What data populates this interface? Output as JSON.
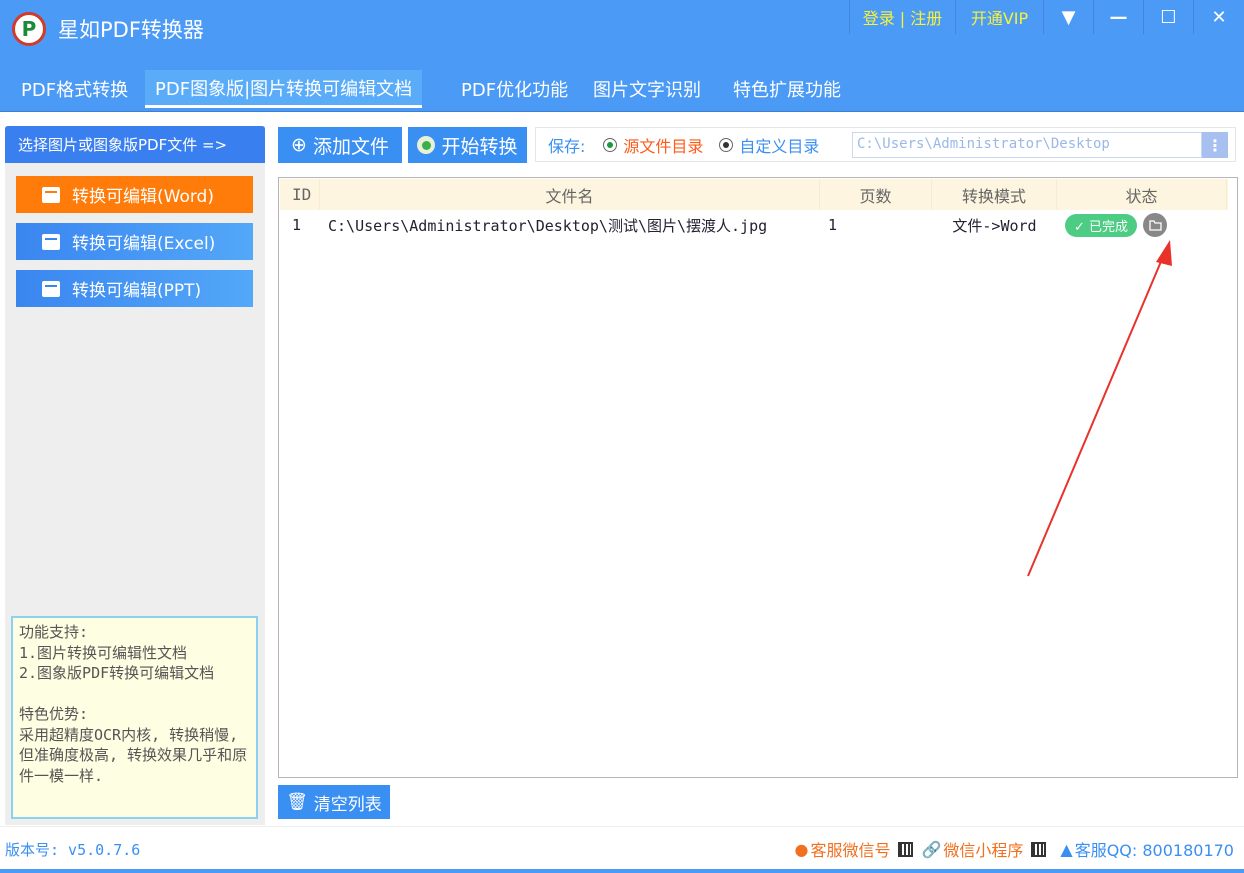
{
  "app": {
    "title": "星如PDF转换器",
    "logo_letter": "P"
  },
  "titlebar": {
    "login": "登录 | 注册",
    "vip": "开通VIP",
    "menu_icon": "▼",
    "minimize": "—",
    "maximize": "☐",
    "close": "✕"
  },
  "tabs": [
    "PDF格式转换",
    "PDF图象版|图片转换可编辑文档",
    "PDF优化功能",
    "图片文字识别",
    "特色扩展功能"
  ],
  "sidebar": {
    "header": "选择图片或图象版PDF文件 =>",
    "items": [
      "转换可编辑(Word)",
      "转换可编辑(Excel)",
      "转换可编辑(PPT)"
    ],
    "info": "功能支持:\n1.图片转换可编辑性文档\n2.图象版PDF转换可编辑文档\n\n特色优势:\n采用超精度OCR内核, 转换稍慢, 但准确度极高, 转换效果几乎和原件一模一样."
  },
  "toolbar": {
    "add_file": "添加文件",
    "start": "开始转换",
    "save_label": "保存:",
    "opt_source": "源文件目录",
    "opt_custom": "自定义目录",
    "path": "C:\\Users\\Administrator\\Desktop",
    "more": "⋮"
  },
  "table": {
    "headers": [
      "ID",
      "文件名",
      "页数",
      "转换模式",
      "状态"
    ],
    "rows": [
      {
        "id": "1",
        "file": "C:\\Users\\Administrator\\Desktop\\测试\\图片\\摆渡人.jpg",
        "pages": "1",
        "mode": "文件->Word",
        "status": "✓ 已完成"
      }
    ]
  },
  "clear_button": "清空列表",
  "footer": {
    "version": "版本号: v5.0.7.6",
    "wechat": "客服微信号",
    "miniprogram": "微信小程序",
    "qq": "客服QQ: 800180170"
  },
  "colors": {
    "primary": "#4b9af6",
    "accent": "#ff7c0a",
    "success": "#4ccd83"
  }
}
